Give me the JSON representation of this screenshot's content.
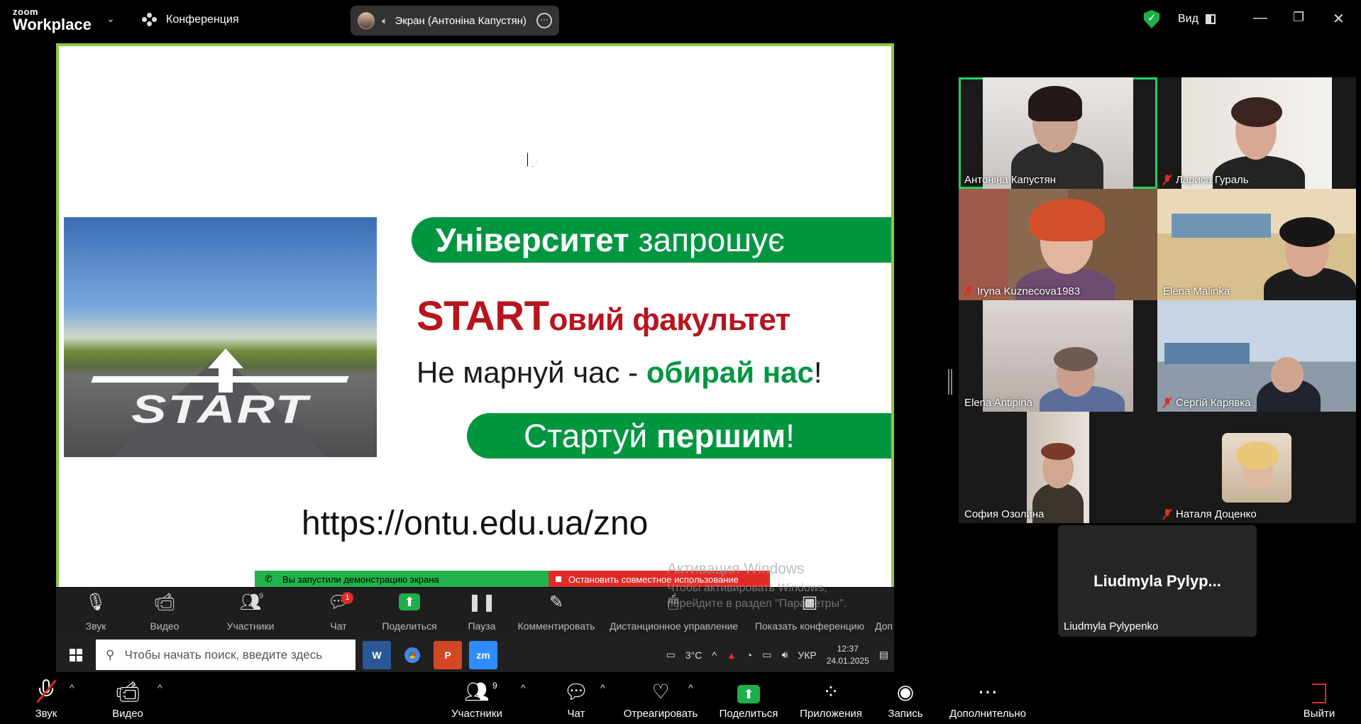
{
  "app": {
    "logo_line1": "zoom",
    "logo_line2": "Workplace"
  },
  "header": {
    "meeting_label": "Конференция",
    "share_label": "Экран (Антоніна Капустян)",
    "view_label": "Вид",
    "secure_color": "#1fae4c"
  },
  "slide": {
    "pill1_bold": "Університет",
    "pill1_rest": " запрошує",
    "line2_start": "START",
    "line2_rest": "овий факультет",
    "line3_a": "Не марнуй час - ",
    "line3_b": "обирай нас",
    "line3_c": "!",
    "pill2_a": "Стартуй ",
    "pill2_b": "першим",
    "pill2_c": "!",
    "url": "https://ontu.edu.ua/zno",
    "road_word": "START",
    "green_color": "#009640",
    "red_color": "#b7141e"
  },
  "share_banner": {
    "started": "Вы запустили демонстрацию экрана",
    "stop": "Остановить совместное использование"
  },
  "watermark": {
    "title": "Активация Windows",
    "line1": "Чтобы активировать Windows,",
    "line2": "перейдите в раздел \"Параметры\"."
  },
  "inner_toolbar": {
    "items": [
      {
        "label": "Звук"
      },
      {
        "label": "Видео"
      },
      {
        "label": "Участники",
        "count": "9"
      },
      {
        "label": "Чат",
        "badge": "1"
      },
      {
        "label": "Поделиться"
      },
      {
        "label": "Пауза"
      },
      {
        "label": "Комментировать"
      },
      {
        "label": "Дистанционное управление"
      },
      {
        "label": "Показать конференцию"
      },
      {
        "label": "Доп"
      }
    ]
  },
  "taskbar": {
    "search_placeholder": "Чтобы начать поиск, введите здесь",
    "temp": "3°C",
    "lang": "УКР",
    "time": "12:37",
    "date": "24.01.2025",
    "zoom_app": "zm"
  },
  "participants": [
    {
      "name": "Антоніна Капустян",
      "muted": false,
      "active": true
    },
    {
      "name": "Лариса Гураль",
      "muted": true
    },
    {
      "name": "Iryna Kuznecova1983",
      "muted": true
    },
    {
      "name": "Elena Malinka",
      "muted": false
    },
    {
      "name": "Elena Antipina",
      "muted": false
    },
    {
      "name": "Сергій Карявка",
      "muted": true
    },
    {
      "name": "София Озолина",
      "muted": false
    },
    {
      "name": "Наталя Доценко",
      "muted": true
    },
    {
      "name": "Liudmyla Pylypenko",
      "display": "Liudmyla  Pylyp...",
      "muted": false
    }
  ],
  "bottom_toolbar": {
    "audio": "Звук",
    "video": "Видео",
    "participants": "Участники",
    "participants_count": "9",
    "chat": "Чат",
    "react": "Отреагировать",
    "share": "Поделиться",
    "apps": "Приложения",
    "record": "Запись",
    "more": "Дополнительно",
    "leave": "Выйти"
  }
}
